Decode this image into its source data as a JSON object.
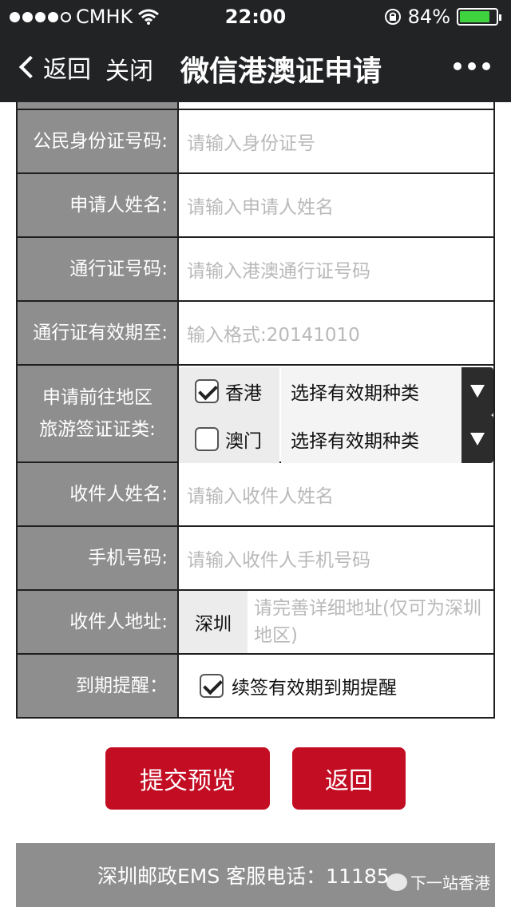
{
  "status_bar": {
    "carrier": "CMHK",
    "time": "22:00",
    "battery": "84%",
    "battery_level": 0.84
  },
  "nav": {
    "back_label": "返回",
    "close_label": "关闭",
    "title": "微信港澳证申请"
  },
  "form": {
    "id_number": {
      "label": "公民身份证号码:",
      "placeholder": "请输入身份证号"
    },
    "applicant_name": {
      "label": "申请人姓名:",
      "placeholder": "请输入申请人姓名"
    },
    "permit_number": {
      "label": "通行证号码:",
      "placeholder": "请输入港澳通行证号码"
    },
    "permit_expiry": {
      "label": "通行证有效期至:",
      "placeholder": "输入格式:20141010"
    },
    "visa": {
      "label_line1": "申请前往地区",
      "label_line2": "旅游签证证类:",
      "options": [
        {
          "name": "香港",
          "checked": true,
          "select_value": "选择有效期种类"
        },
        {
          "name": "澳门",
          "checked": false,
          "select_value": "选择有效期种类"
        }
      ]
    },
    "recipient_name": {
      "label": "收件人姓名:",
      "placeholder": "请输入收件人姓名"
    },
    "mobile": {
      "label": "手机号码:",
      "placeholder": "请输入收件人手机号码"
    },
    "address": {
      "label": "收件人地址:",
      "city": "深圳",
      "placeholder": "请完善详细地址(仅可为深圳地区)"
    },
    "reminder": {
      "label": "到期提醒：",
      "option_label": "续签有效期到期提醒",
      "checked": true
    }
  },
  "buttons": {
    "preview": "提交预览",
    "back": "返回"
  },
  "footer": {
    "text": "深圳邮政EMS 客服电话：11185",
    "watermark": "下一站香港"
  }
}
